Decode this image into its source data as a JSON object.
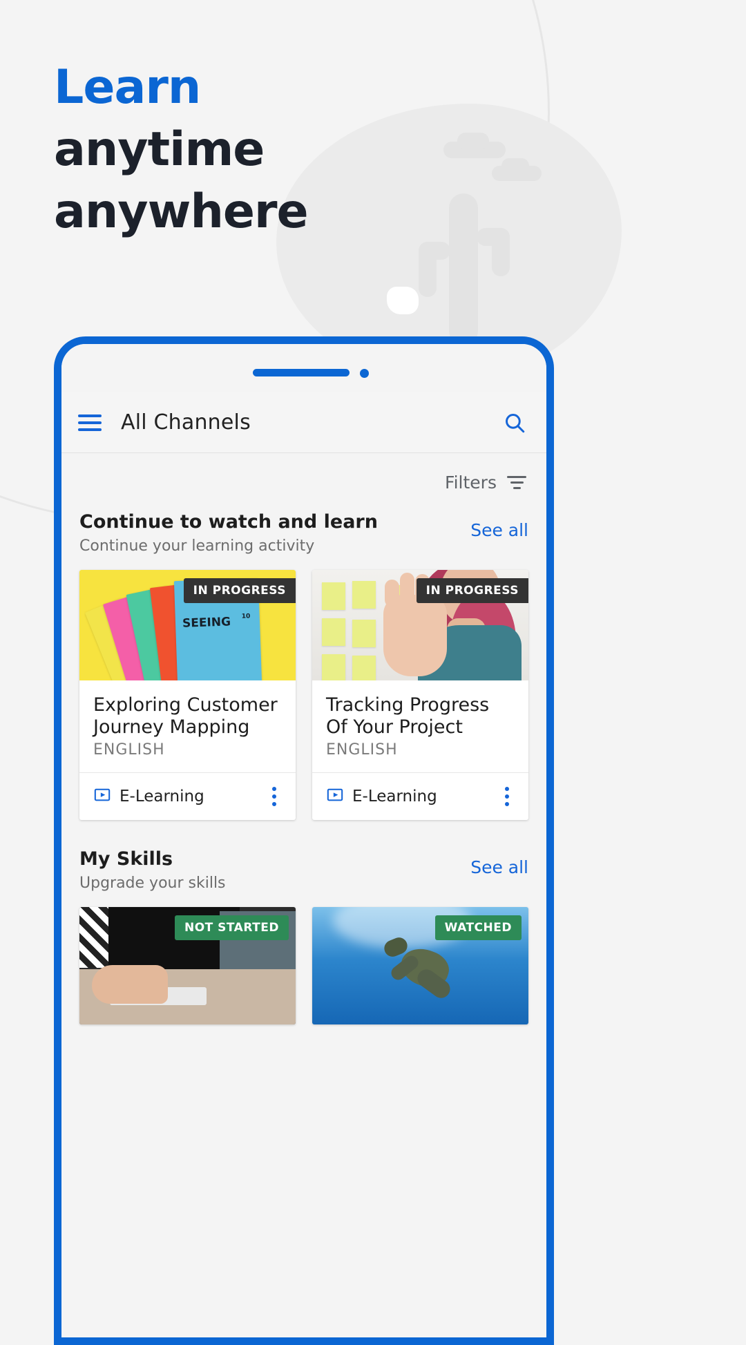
{
  "hero": {
    "line1": "Learn",
    "line2": "anytime",
    "line3": "anywhere",
    "accent_color": "#0b66d3",
    "dark_color": "#1c212b"
  },
  "phone": {
    "frame_color": "#0b66d3",
    "appbar": {
      "menu_icon": "hamburger-icon",
      "title": "All Channels",
      "search_icon": "search-icon"
    },
    "filters": {
      "label": "Filters",
      "icon": "filter-icon"
    },
    "sections": [
      {
        "title": "Continue to watch and learn",
        "subtitle": "Continue your learning activity",
        "see_all": "See all",
        "cards": [
          {
            "badge": "IN PROGRESS",
            "badge_color": "#333333",
            "title": "Exploring Customer Journey Mapping",
            "language": "ENGLISH",
            "type": "E-Learning",
            "type_icon": "video-play-icon",
            "menu_icon": "kebab-menu-icon",
            "thumb": "notebooks-on-yellow"
          },
          {
            "badge": "IN PROGRESS",
            "badge_color": "#333333",
            "title": "Tracking Progress Of Your Project",
            "language": "ENGLISH",
            "type": "E-Learning",
            "type_icon": "video-play-icon",
            "menu_icon": "kebab-menu-icon",
            "thumb": "woman-with-sticky-notes"
          }
        ]
      },
      {
        "title": "My Skills",
        "subtitle": "Upgrade your skills",
        "see_all": "See all",
        "cards": [
          {
            "badge": "NOT STARTED",
            "badge_color": "#2e8b57",
            "thumb": "hands-on-laptop"
          },
          {
            "badge": "WATCHED",
            "badge_color": "#2e8b57",
            "thumb": "sea-turtle-underwater"
          }
        ]
      }
    ]
  }
}
